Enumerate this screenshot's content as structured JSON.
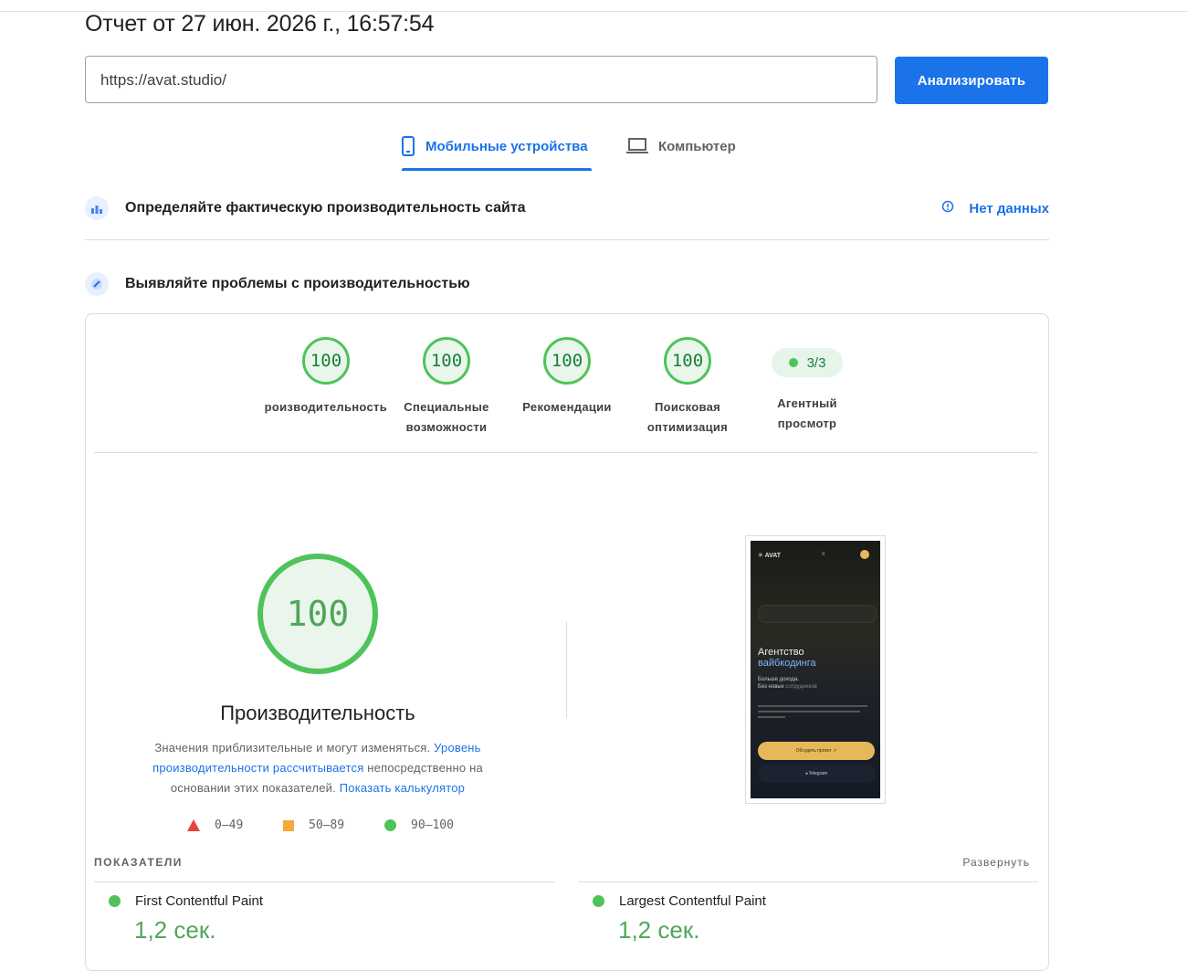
{
  "header": {
    "report_title": "Отчет от 27 июн. 2026 г., 16:57:54",
    "url_value": "https://avat.studio/",
    "analyze_label": "Анализировать"
  },
  "tabs": [
    {
      "label": "Мобильные устройства",
      "active": true,
      "icon": "smartphone-icon"
    },
    {
      "label": "Компьютер",
      "active": false,
      "icon": "laptop-icon"
    }
  ],
  "field_data": {
    "title": "Определяйте фактическую производительность сайта",
    "status": "Нет данных"
  },
  "lab_data": {
    "title": "Выявляйте проблемы с производительностью"
  },
  "scores": [
    {
      "value": "100",
      "label_line1": "Производительность",
      "label_line2": ""
    },
    {
      "value": "100",
      "label_line1": "Специальные",
      "label_line2": "возможности"
    },
    {
      "value": "100",
      "label_line1": "Рекомендации",
      "label_line2": ""
    },
    {
      "value": "100",
      "label_line1": "Поисковая",
      "label_line2": "оптимизация"
    }
  ],
  "agent_view": {
    "value": "3/3",
    "label_line1": "Агентный",
    "label_line2": "просмотр"
  },
  "main_score": {
    "value": "100",
    "label": "Производительность",
    "note_part1": "Значения приблизительные и могут изменяться. ",
    "note_link1": "Уровень производительности рассчитывается",
    "note_part2": " непосредственно на основании этих показателей. ",
    "note_link2": "Показать калькулятор"
  },
  "legend": [
    {
      "range": "0–49",
      "color": "#e8453c",
      "shape": "triangle"
    },
    {
      "range": "50–89",
      "color": "#f4a93b",
      "shape": "square"
    },
    {
      "range": "90–100",
      "color": "#4fc35a",
      "shape": "circle"
    }
  ],
  "screenshot": {
    "brand": "AVAT",
    "headline1": "Агентство",
    "headline2": "вайбкодинга",
    "sub1": "Больше дохода.",
    "sub2": "Без новых",
    "sub2b": "сотрудников",
    "cta": "Обсудить проект ↗",
    "telegram": "◂ Telegram"
  },
  "metrics_section": {
    "title": "ПОКАЗАТЕЛИ",
    "expand": "Развернуть"
  },
  "metrics": [
    {
      "name": "First Contentful Paint",
      "value": "1,2 сек."
    },
    {
      "name": "Largest Contentful Paint",
      "value": "1,2 сек."
    }
  ]
}
